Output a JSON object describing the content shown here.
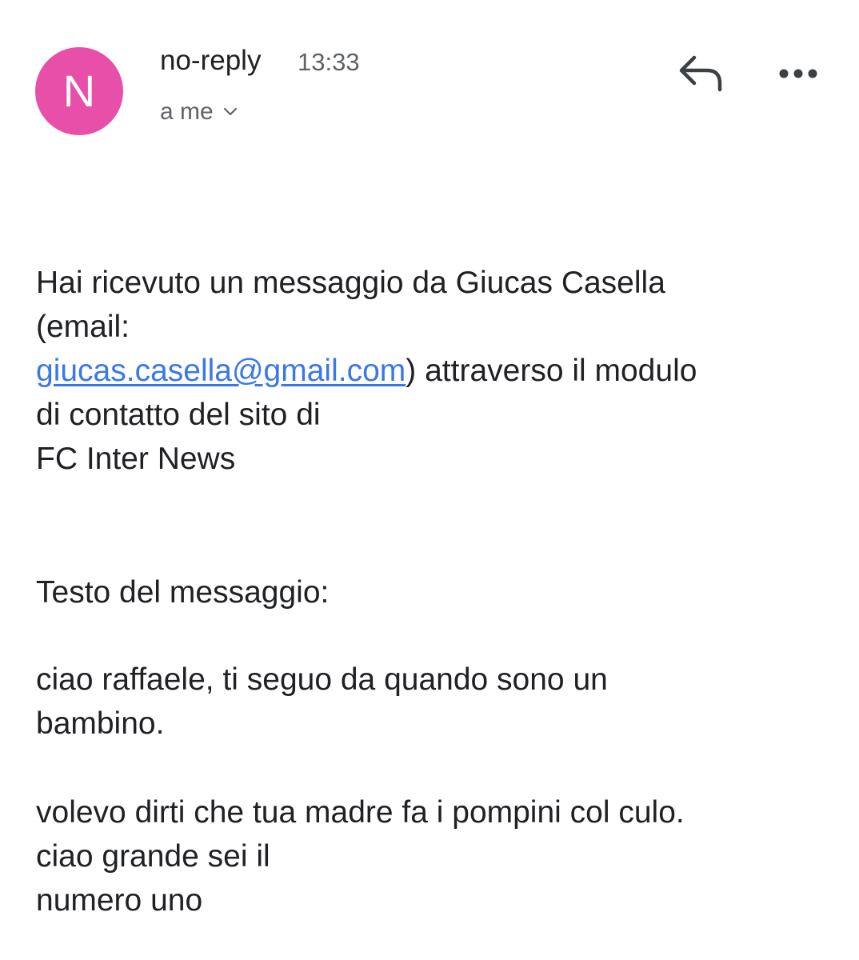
{
  "header": {
    "avatar_letter": "N",
    "avatar_color": "#e84fa8",
    "sender": "no-reply",
    "time": "13:33",
    "recipient": "a me",
    "icons": {
      "reply": "reply-icon",
      "more": "more-horizontal-icon",
      "expand": "chevron-down-icon"
    }
  },
  "body": {
    "intro_before_link": "Hai ricevuto un messaggio da Giucas Casella\n(email:\n",
    "email_link": "giucas.casella@gmail.com",
    "intro_after_link": ") attraverso il modulo\ndi contatto del sito di\nFC Inter News",
    "message_heading": "Testo del messaggio:",
    "message_paragraph_1": "ciao raffaele, ti seguo da quando sono un\nbambino.",
    "message_paragraph_2": "volevo dirti che tua madre fa i pompini col culo.\nciao grande sei il\nnumero uno"
  },
  "colors": {
    "link": "#3b78e7",
    "text": "#202124",
    "secondary_text": "#5f6368"
  }
}
